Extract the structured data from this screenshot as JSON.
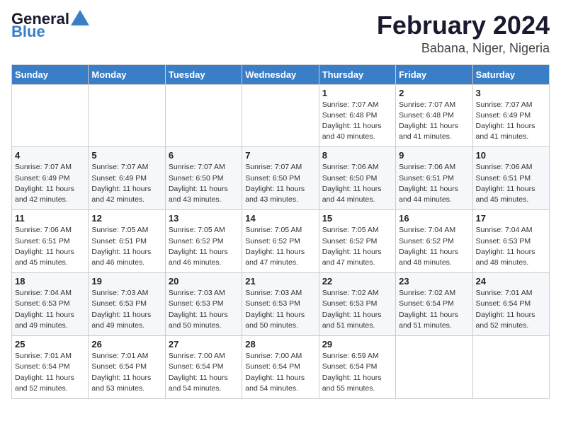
{
  "header": {
    "logo_line1": "General",
    "logo_line2": "Blue",
    "title": "February 2024",
    "location": "Babana, Niger, Nigeria"
  },
  "weekdays": [
    "Sunday",
    "Monday",
    "Tuesday",
    "Wednesday",
    "Thursday",
    "Friday",
    "Saturday"
  ],
  "weeks": [
    [
      {
        "day": "",
        "info": ""
      },
      {
        "day": "",
        "info": ""
      },
      {
        "day": "",
        "info": ""
      },
      {
        "day": "",
        "info": ""
      },
      {
        "day": "1",
        "info": "Sunrise: 7:07 AM\nSunset: 6:48 PM\nDaylight: 11 hours\nand 40 minutes."
      },
      {
        "day": "2",
        "info": "Sunrise: 7:07 AM\nSunset: 6:48 PM\nDaylight: 11 hours\nand 41 minutes."
      },
      {
        "day": "3",
        "info": "Sunrise: 7:07 AM\nSunset: 6:49 PM\nDaylight: 11 hours\nand 41 minutes."
      }
    ],
    [
      {
        "day": "4",
        "info": "Sunrise: 7:07 AM\nSunset: 6:49 PM\nDaylight: 11 hours\nand 42 minutes."
      },
      {
        "day": "5",
        "info": "Sunrise: 7:07 AM\nSunset: 6:49 PM\nDaylight: 11 hours\nand 42 minutes."
      },
      {
        "day": "6",
        "info": "Sunrise: 7:07 AM\nSunset: 6:50 PM\nDaylight: 11 hours\nand 43 minutes."
      },
      {
        "day": "7",
        "info": "Sunrise: 7:07 AM\nSunset: 6:50 PM\nDaylight: 11 hours\nand 43 minutes."
      },
      {
        "day": "8",
        "info": "Sunrise: 7:06 AM\nSunset: 6:50 PM\nDaylight: 11 hours\nand 44 minutes."
      },
      {
        "day": "9",
        "info": "Sunrise: 7:06 AM\nSunset: 6:51 PM\nDaylight: 11 hours\nand 44 minutes."
      },
      {
        "day": "10",
        "info": "Sunrise: 7:06 AM\nSunset: 6:51 PM\nDaylight: 11 hours\nand 45 minutes."
      }
    ],
    [
      {
        "day": "11",
        "info": "Sunrise: 7:06 AM\nSunset: 6:51 PM\nDaylight: 11 hours\nand 45 minutes."
      },
      {
        "day": "12",
        "info": "Sunrise: 7:05 AM\nSunset: 6:51 PM\nDaylight: 11 hours\nand 46 minutes."
      },
      {
        "day": "13",
        "info": "Sunrise: 7:05 AM\nSunset: 6:52 PM\nDaylight: 11 hours\nand 46 minutes."
      },
      {
        "day": "14",
        "info": "Sunrise: 7:05 AM\nSunset: 6:52 PM\nDaylight: 11 hours\nand 47 minutes."
      },
      {
        "day": "15",
        "info": "Sunrise: 7:05 AM\nSunset: 6:52 PM\nDaylight: 11 hours\nand 47 minutes."
      },
      {
        "day": "16",
        "info": "Sunrise: 7:04 AM\nSunset: 6:52 PM\nDaylight: 11 hours\nand 48 minutes."
      },
      {
        "day": "17",
        "info": "Sunrise: 7:04 AM\nSunset: 6:53 PM\nDaylight: 11 hours\nand 48 minutes."
      }
    ],
    [
      {
        "day": "18",
        "info": "Sunrise: 7:04 AM\nSunset: 6:53 PM\nDaylight: 11 hours\nand 49 minutes."
      },
      {
        "day": "19",
        "info": "Sunrise: 7:03 AM\nSunset: 6:53 PM\nDaylight: 11 hours\nand 49 minutes."
      },
      {
        "day": "20",
        "info": "Sunrise: 7:03 AM\nSunset: 6:53 PM\nDaylight: 11 hours\nand 50 minutes."
      },
      {
        "day": "21",
        "info": "Sunrise: 7:03 AM\nSunset: 6:53 PM\nDaylight: 11 hours\nand 50 minutes."
      },
      {
        "day": "22",
        "info": "Sunrise: 7:02 AM\nSunset: 6:53 PM\nDaylight: 11 hours\nand 51 minutes."
      },
      {
        "day": "23",
        "info": "Sunrise: 7:02 AM\nSunset: 6:54 PM\nDaylight: 11 hours\nand 51 minutes."
      },
      {
        "day": "24",
        "info": "Sunrise: 7:01 AM\nSunset: 6:54 PM\nDaylight: 11 hours\nand 52 minutes."
      }
    ],
    [
      {
        "day": "25",
        "info": "Sunrise: 7:01 AM\nSunset: 6:54 PM\nDaylight: 11 hours\nand 52 minutes."
      },
      {
        "day": "26",
        "info": "Sunrise: 7:01 AM\nSunset: 6:54 PM\nDaylight: 11 hours\nand 53 minutes."
      },
      {
        "day": "27",
        "info": "Sunrise: 7:00 AM\nSunset: 6:54 PM\nDaylight: 11 hours\nand 54 minutes."
      },
      {
        "day": "28",
        "info": "Sunrise: 7:00 AM\nSunset: 6:54 PM\nDaylight: 11 hours\nand 54 minutes."
      },
      {
        "day": "29",
        "info": "Sunrise: 6:59 AM\nSunset: 6:54 PM\nDaylight: 11 hours\nand 55 minutes."
      },
      {
        "day": "",
        "info": ""
      },
      {
        "day": "",
        "info": ""
      }
    ]
  ]
}
